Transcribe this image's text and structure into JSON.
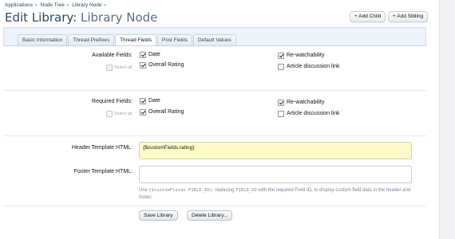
{
  "breadcrumb": [
    "Applications",
    "Node Tree",
    "Library Node"
  ],
  "breadcrumb_sep": "»",
  "title": {
    "prefix": "Edit Library:",
    "name": "Library Node"
  },
  "top_buttons": {
    "add_child": "+ Add Child",
    "add_sibling": "+ Add Sibling"
  },
  "tabs": [
    {
      "label": "Basic Information",
      "active": false
    },
    {
      "label": "Thread Prefixes",
      "active": false
    },
    {
      "label": "Thread Fields",
      "active": true
    },
    {
      "label": "Post Fields",
      "active": false
    },
    {
      "label": "Default Values",
      "active": false
    }
  ],
  "available": {
    "label": "Available Fields:",
    "select_all": "Select all",
    "fields": [
      {
        "label": "Date",
        "checked": true
      },
      {
        "label": "Overall Rating",
        "checked": true
      },
      {
        "label": "Re-watchability",
        "checked": true
      },
      {
        "label": "Article discussion link",
        "checked": false
      }
    ]
  },
  "required": {
    "label": "Required Fields:",
    "select_all": "Select all",
    "fields": [
      {
        "label": "Date",
        "checked": true
      },
      {
        "label": "Overall Rating",
        "checked": true
      },
      {
        "label": "Re-watchability",
        "checked": true
      },
      {
        "label": "Article discussion link",
        "checked": false
      }
    ]
  },
  "header_template": {
    "label": "Header Template HTML:",
    "value": "{$customFields.rating}"
  },
  "footer_template": {
    "label": "Footer Template HTML:",
    "value": ""
  },
  "help": {
    "part1": "Use ",
    "code1": "{$customFields.FIELD_ID}",
    "part2": ", replacing ",
    "code2": "FIELD_ID",
    "part3": " with the required Field ID, to display custom field data in the header and footer."
  },
  "actions": {
    "save": "Save Library",
    "delete": "Delete Library..."
  },
  "colors": {
    "highlight_field": "#fefbc8",
    "panel": "#edf3fb",
    "title": "#2b485c"
  }
}
